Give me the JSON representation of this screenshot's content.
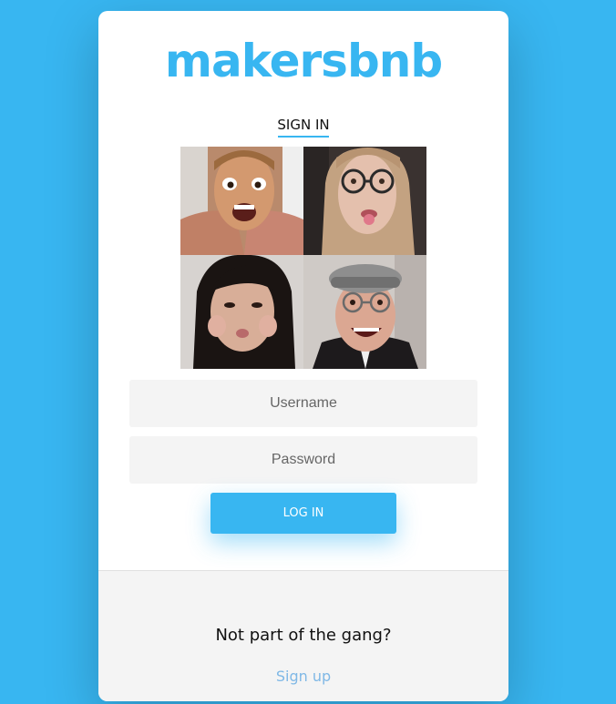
{
  "brand": {
    "logo_text": "makersbnb",
    "accent_color": "#38b6f1"
  },
  "tabs": {
    "active_label": "SIGN IN"
  },
  "photos": [
    {
      "name": "photo-person-1"
    },
    {
      "name": "photo-person-2"
    },
    {
      "name": "photo-person-3"
    },
    {
      "name": "photo-person-4"
    }
  ],
  "form": {
    "username_placeholder": "Username",
    "password_placeholder": "Password",
    "login_label": "LOG IN"
  },
  "footer": {
    "prompt": "Not part of the gang?",
    "signup_label": "Sign up"
  }
}
